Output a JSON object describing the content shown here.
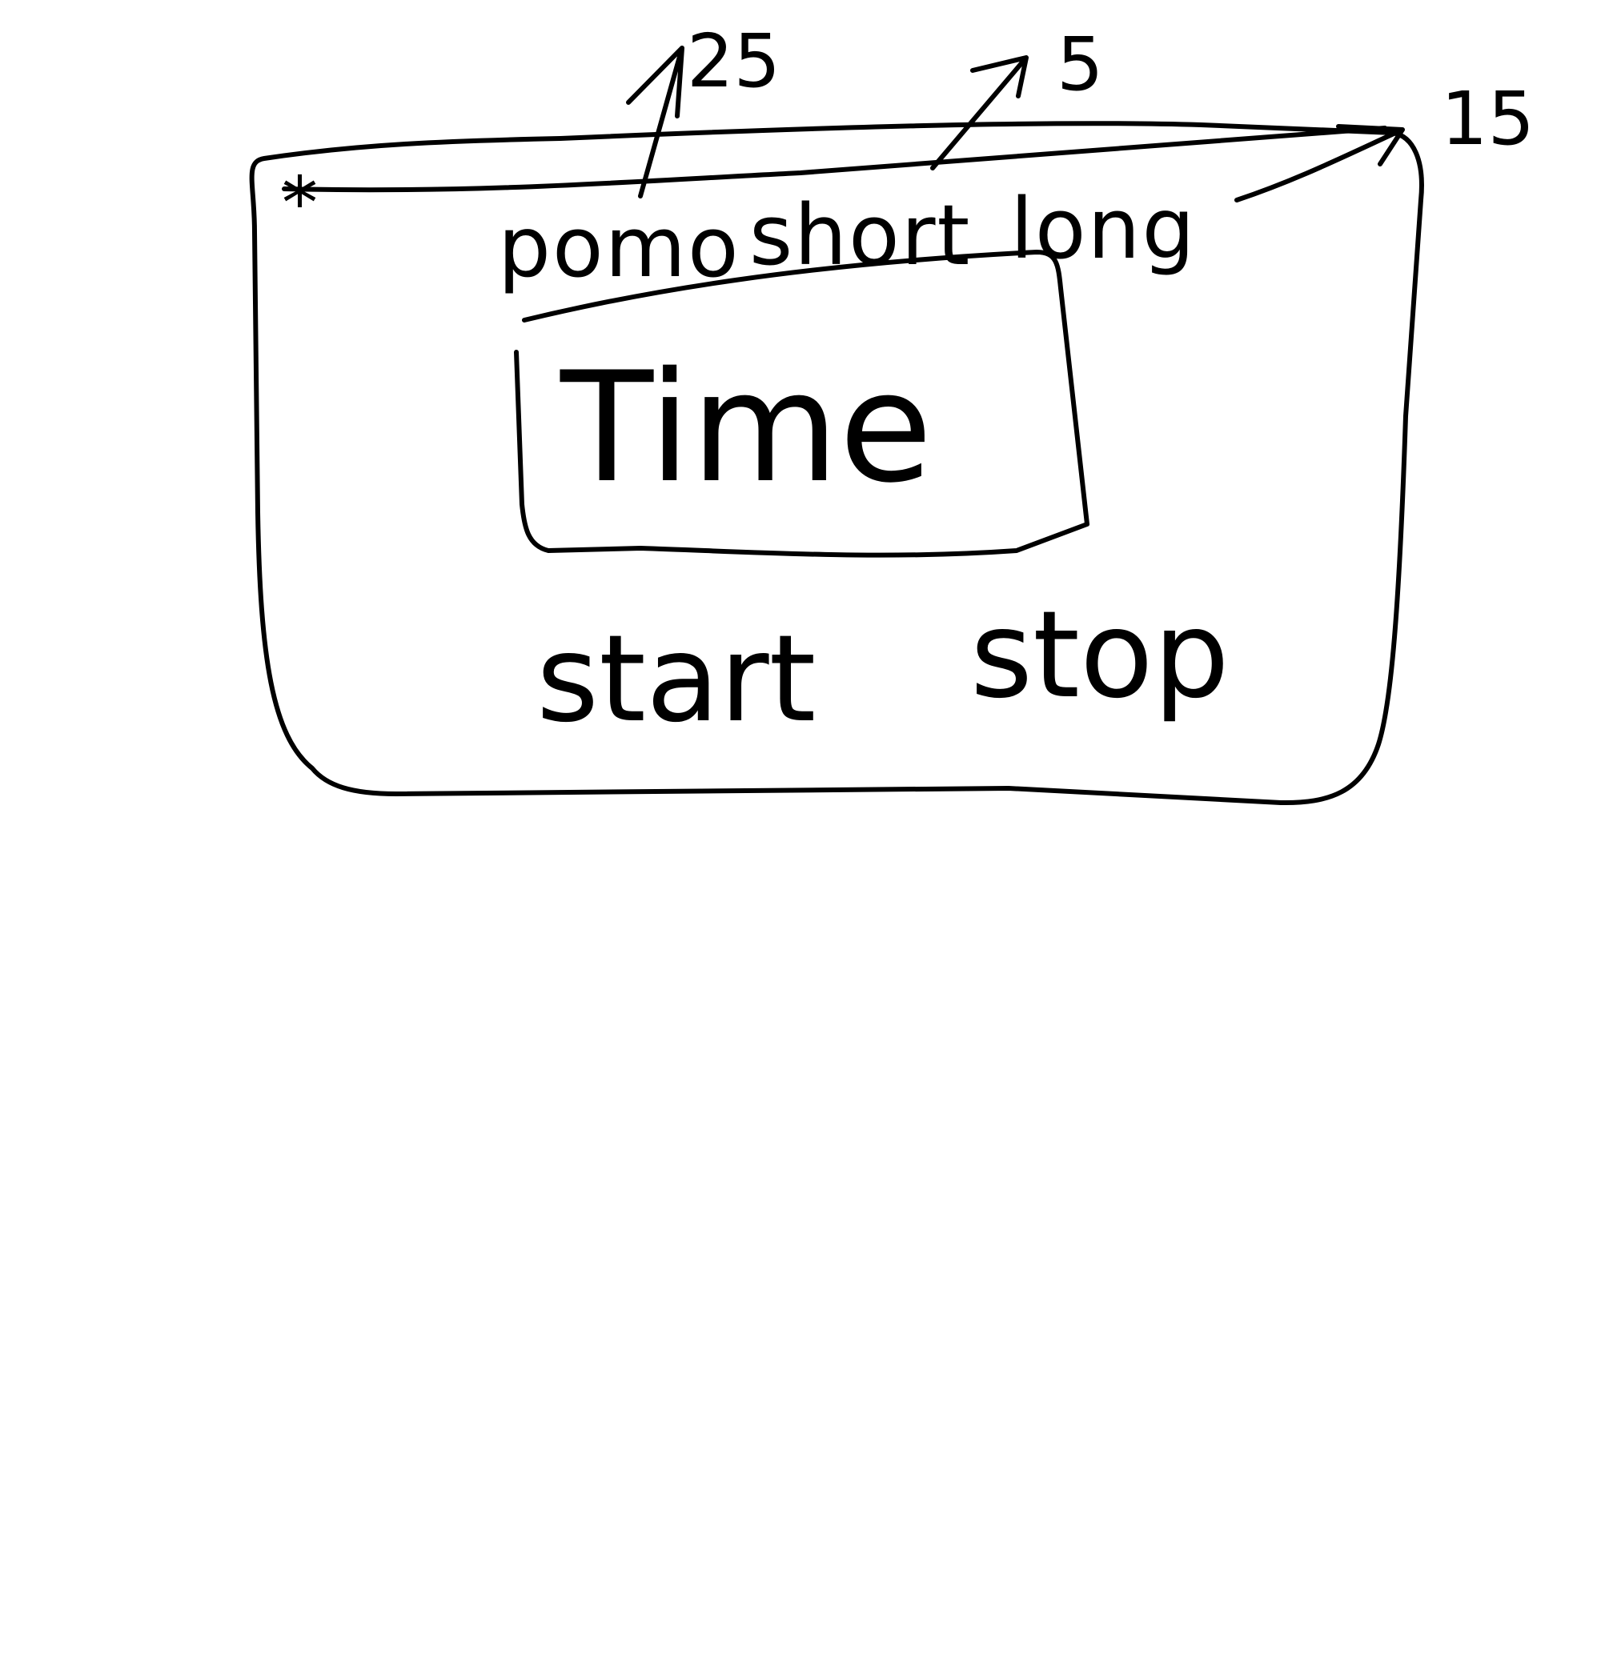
{
  "window": {
    "close_label": "*"
  },
  "tabs": [
    {
      "label": "pomo",
      "duration": "25"
    },
    {
      "label": "short",
      "duration": "5"
    },
    {
      "label": "long",
      "duration": "15"
    }
  ],
  "timer": {
    "display": "Time"
  },
  "controls": {
    "start_label": "start",
    "stop_label": "stop"
  }
}
